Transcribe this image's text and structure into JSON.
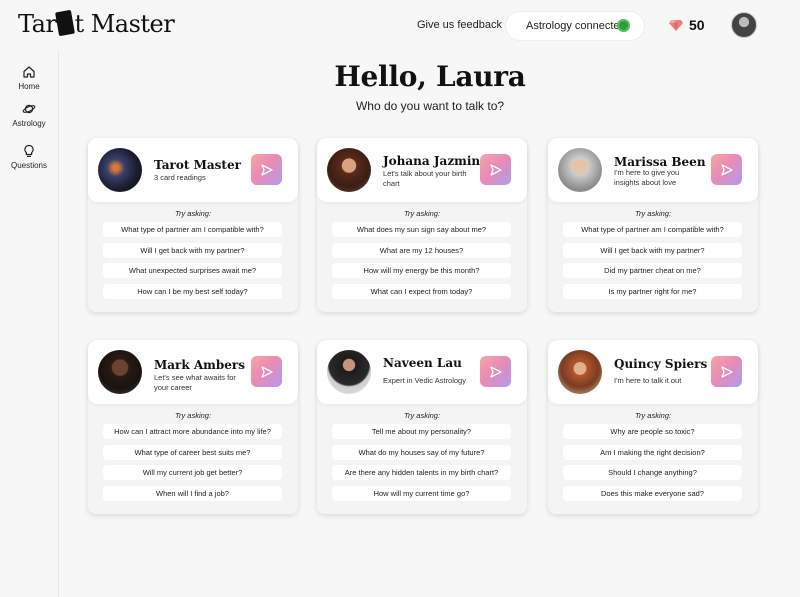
{
  "header": {
    "logo_text_left": "Tar",
    "logo_text_right": "t Master",
    "feedback_label": "Give us feedback",
    "astrology_label": "Astrology connected",
    "credits": "50"
  },
  "sidebar": {
    "items": [
      {
        "label": "Home",
        "icon": "home-icon"
      },
      {
        "label": "Astrology",
        "icon": "planet-icon"
      },
      {
        "label": "Questions",
        "icon": "lightbulb-icon"
      }
    ]
  },
  "main": {
    "greeting": "Hello, Laura",
    "subtitle": "Who do you want to talk to?",
    "try_label": "Try asking:",
    "advisors": [
      {
        "name": "Tarot Master",
        "description": "3 card readings",
        "questions": [
          "What type of partner am I compatible with?",
          "Will I get back with my partner?",
          "What unexpected surprises await me?",
          "How can I be my best self today?"
        ]
      },
      {
        "name": "Johana Jazmin",
        "description": "Let's talk about your birth chart",
        "questions": [
          "What does my sun sign say about me?",
          "What are my 12 houses?",
          "How will my energy be this month?",
          "What can I expect from today?"
        ]
      },
      {
        "name": "Marissa Been",
        "description": "I'm here to give you insights about love",
        "questions": [
          "What type of partner am I compatible with?",
          "Will I get back with my partner?",
          "Did my partner cheat on me?",
          "Is my partner right for me?"
        ]
      },
      {
        "name": "Mark Ambers",
        "description": "Let's see what awaits for your career",
        "questions": [
          "How can I attract more abundance into my life?",
          "What type of career best suits me?",
          "Will my current job get better?",
          "When will I find a job?"
        ]
      },
      {
        "name": "Naveen Lau",
        "description": "Expert in Vedic Astrology",
        "questions": [
          "Tell me about my personality?",
          "What do my houses say of my future?",
          "Are there any hidden talents in my birth chart?",
          "How will my current time go?"
        ]
      },
      {
        "name": "Quincy Spiers",
        "description": "I'm here to talk it out",
        "questions": [
          "Why are people so toxic?",
          "Am I making the right decision?",
          "Should I change anything?",
          "Does this make everyone sad?"
        ]
      }
    ]
  },
  "colors": {
    "background": "#f7f7f7",
    "status_green": "#2f9e3a",
    "send_gradient_start": "#f6a5a5",
    "send_gradient_end": "#b09af0"
  }
}
